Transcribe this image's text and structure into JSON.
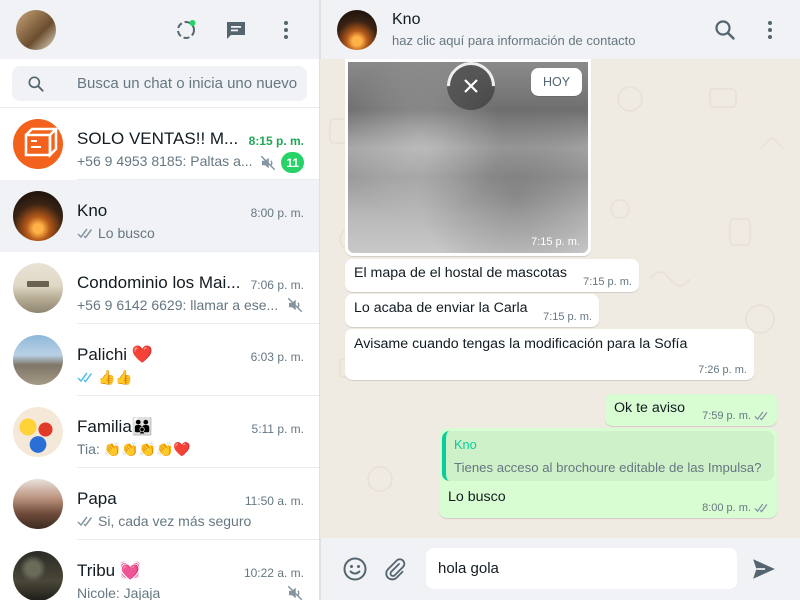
{
  "sidebar": {
    "search_placeholder": "Busca un chat o inicia uno nuevo",
    "chats": [
      {
        "name": "SOLO VENTAS!! M...",
        "time": "8:15 p. m.",
        "preview": "+56 9 4953 8185: Paltas a...",
        "unread": "11",
        "muted": true,
        "time_unread": true
      },
      {
        "name": "Kno",
        "time": "8:00 p. m.",
        "preview": "Lo busco",
        "ticks": "read-grey"
      },
      {
        "name": "Condominio los Mai...",
        "time": "7:06 p. m.",
        "preview": "+56 9 6142 6629: llamar a ese...",
        "muted": true
      },
      {
        "name": "Palichi ❤️",
        "time": "6:03 p. m.",
        "preview": "👍👍",
        "ticks": "read-blue"
      },
      {
        "name": "Familia👪",
        "time": "5:11 p. m.",
        "preview": "Tia: 👏👏👏👏❤️"
      },
      {
        "name": "Papa",
        "time": "11:50 a. m.",
        "preview": "Si, cada vez más seguro",
        "ticks": "read-grey"
      },
      {
        "name": "Tribu 💓",
        "time": "10:22 a. m.",
        "preview": "Nicole: Jajaja",
        "muted": true
      }
    ]
  },
  "conversation": {
    "contact_name": "Kno",
    "contact_sub": "haz clic aquí para información de contacto",
    "day_label": "HOY",
    "image_time": "7:15 p. m.",
    "messages": [
      {
        "text": "El mapa de el hostal de mascotas",
        "time": "7:15 p. m."
      },
      {
        "text": "Lo acaba de enviar la Carla",
        "time": "7:15 p. m."
      },
      {
        "text": "Avisame cuando tengas la modificación para la Sofía",
        "time": "7:26 p. m."
      },
      {
        "text": "Ok te aviso",
        "time": "7:59 p. m."
      },
      {
        "quote_name": "Kno",
        "quote_text": "Tienes acceso al brochoure editable de las Impulsa?",
        "text": "Lo busco",
        "time": "8:00 p. m."
      }
    ]
  },
  "composer": {
    "value": "hola gola"
  },
  "colors": {
    "accent": "#25d366",
    "outgoing": "#d9fdd3",
    "header": "#f0f2f5",
    "wallpaper": "#efeae2",
    "read_blue": "#53bdeb"
  }
}
